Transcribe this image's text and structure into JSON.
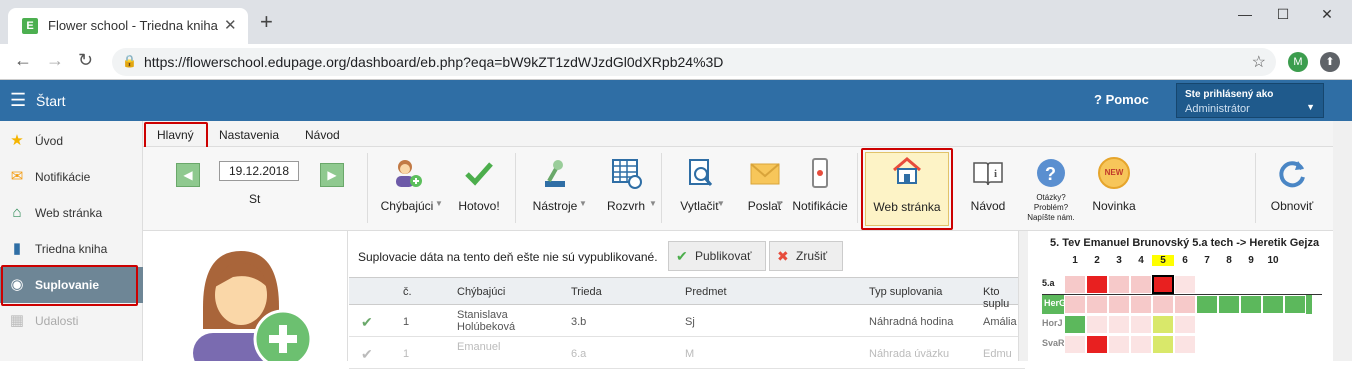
{
  "browser": {
    "tab_title": "Flower school - Triedna kniha",
    "tab_favicon": "E",
    "url": "https://flowerschool.edupage.org/dashboard/eb.php?eqa=bW9kZT1zdWJzdGl0dXRpb24%3D",
    "profile_initial": "M",
    "icons": [
      "back-arrow-icon",
      "forward-arrow-icon",
      "reload-icon",
      "lock-icon",
      "star-icon",
      "new-tab-icon",
      "close-icon",
      "minimize-icon",
      "maximize-icon"
    ]
  },
  "app": {
    "title": "Štart",
    "help": "Pomoc",
    "user_label": "Ste prihlásený ako",
    "user_name": "Administrátor",
    "brand_color": "#2f6ea5"
  },
  "sidebar": {
    "items": [
      {
        "label": "Úvod",
        "icon": "star-icon"
      },
      {
        "label": "Notifikácie",
        "icon": "envelope-icon"
      },
      {
        "label": "Web stránka",
        "icon": "home-icon"
      },
      {
        "label": "Triedna kniha",
        "icon": "book-icon"
      },
      {
        "label": "Suplovanie",
        "icon": "user-circle-icon"
      },
      {
        "label": "Udalosti",
        "icon": "calendar-icon"
      }
    ]
  },
  "subtabs": [
    "Hlavný",
    "Nastavenia",
    "Návod"
  ],
  "toolbar": {
    "date": "19.12.2018",
    "day": "St",
    "buttons": {
      "chybajuci": "Chýbajúci",
      "hotovo": "Hotovo!",
      "nastroje": "Nástroje",
      "rozvrh": "Rozvrh",
      "vytlacit": "Vytlačiť",
      "poslat": "Poslať",
      "notifikacie": "Notifikácie",
      "web": "Web stránka",
      "navod": "Návod",
      "otazky": "Otázky? Problém? Napíšte nám.",
      "novinka": "Novinka",
      "new_badge": "NEW",
      "obnovit": "Obnoviť"
    }
  },
  "notice": "Suplovacie dáta na tento deň ešte nie sú vypublikované.",
  "actions": {
    "publish": "Publikovať",
    "cancel": "Zrušiť"
  },
  "table": {
    "headers": [
      "č.",
      "Chýbajúci",
      "Trieda",
      "Predmet",
      "Typ suplovania",
      "Kto suplu"
    ],
    "rows": [
      {
        "num": "1",
        "teacher": "Stanislava Holúbeková",
        "class": "3.b",
        "subject": "Sj",
        "type": "Náhradná hodina",
        "who": "Amália"
      },
      {
        "num": "1",
        "teacher": "Emanuel",
        "class": "6.a",
        "subject": "M",
        "type": "Náhrada úväzku",
        "who": "Edmu"
      }
    ]
  },
  "timetable": {
    "title": "5. Tev Emanuel Brunovský 5.a tech -> Heretik Gejza",
    "periods": [
      "1",
      "2",
      "3",
      "4",
      "5",
      "6",
      "7",
      "8",
      "9",
      "10"
    ],
    "rows": [
      "5.a",
      "HerG",
      "HorJ",
      "SvaR"
    ]
  }
}
